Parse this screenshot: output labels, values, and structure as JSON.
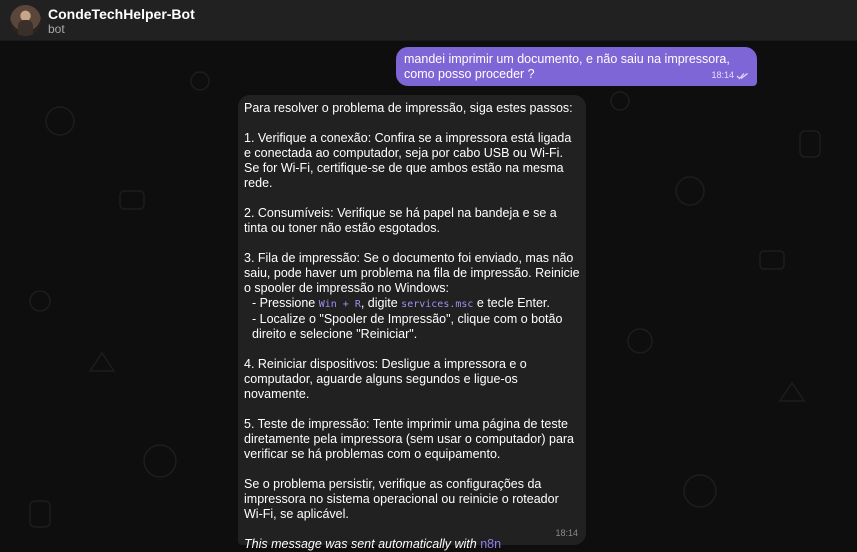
{
  "header": {
    "title": "CondeTechHelper-Bot",
    "subtitle": "bot"
  },
  "messages": {
    "outgoing": {
      "text": "mandei imprimir um documento, e não saiu na impressora, como posso proceder ?",
      "time": "18:14"
    },
    "incoming": {
      "intro": "Para resolver o problema de impressão, siga estes passos:",
      "step1": "1. Verifique a conexão: Confira se a impressora está ligada e conectada ao computador, seja por cabo USB ou Wi-Fi. Se for Wi-Fi, certifique-se de que ambos estão na mesma rede.",
      "step2": "2. Consumíveis: Verifique se há papel na bandeja e se a tinta ou toner não estão esgotados.",
      "step3": "3. Fila de impressão: Se o documento foi enviado, mas não saiu, pode haver um problema na fila de impressão. Reinicie o spooler de impressão no Windows:",
      "step3_sub1_pre": "- Pressione ",
      "step3_sub1_code1": "Win + R",
      "step3_sub1_mid": ", digite ",
      "step3_sub1_code2": "services.msc",
      "step3_sub1_post": " e tecle Enter.",
      "step3_sub2": "- Localize o \"Spooler de Impressão\", clique com o botão direito e selecione \"Reiniciar\".",
      "step4": "4. Reiniciar dispositivos: Desligue a impressora e o computador, aguarde alguns segundos e ligue-os novamente.",
      "step5": "5. Teste de impressão: Tente imprimir uma página de teste diretamente pela impressora (sem usar o computador) para verificar se há problemas com o equipamento.",
      "closing": "Se o problema persistir, verifique as configurações da impressora no sistema operacional ou reinicie o roteador Wi-Fi, se aplicável.",
      "footer_text": "This message was sent automatically with ",
      "footer_link": "n8n",
      "time": "18:14"
    }
  },
  "colors": {
    "outgoing_bubble": "#7f66d6",
    "incoming_bubble": "#212121",
    "header": "#212121",
    "background": "#0e0e0e",
    "code": "#a28cf0"
  }
}
